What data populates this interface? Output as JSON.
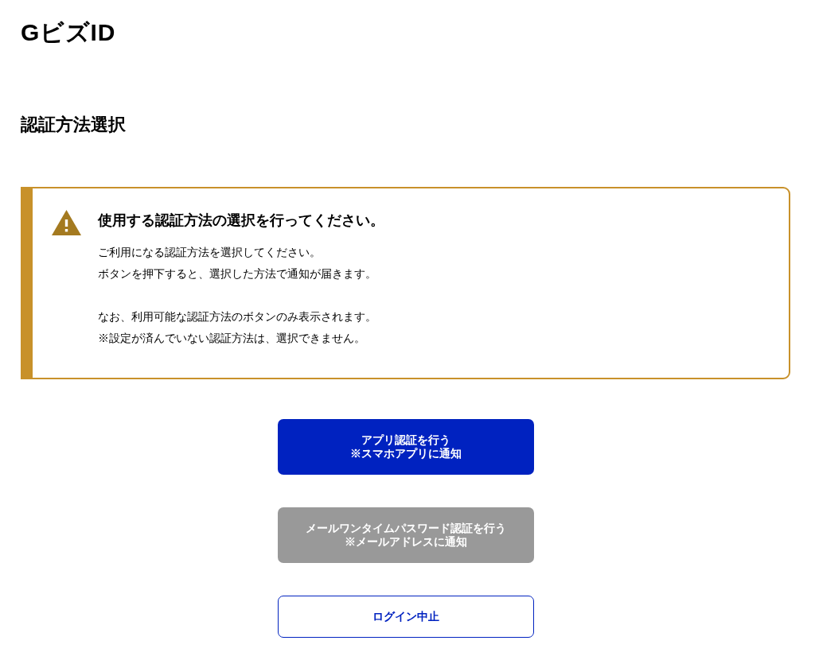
{
  "logo": {
    "text": "GビズID"
  },
  "heading": "認証方法選択",
  "alert": {
    "title": "使用する認証方法の選択を行ってください。",
    "paragraphs": [
      [
        "ご利用になる認証方法を選択してください。",
        "ボタンを押下すると、選択した方法で通知が届きます。"
      ],
      [
        "なお、利用可能な認証方法のボタンのみ表示されます。",
        "※設定が済んでいない認証方法は、選択できません。"
      ]
    ]
  },
  "buttons": [
    {
      "kind": "primary",
      "disabled": false,
      "lines": [
        "アプリ認証を行う",
        "※スマホアプリに通知"
      ]
    },
    {
      "kind": "primary",
      "disabled": true,
      "lines": [
        "メールワンタイムパスワード認証を行う",
        "※メールアドレスに通知"
      ]
    },
    {
      "kind": "outline",
      "disabled": false,
      "lines": [
        "ログイン中止"
      ]
    }
  ]
}
